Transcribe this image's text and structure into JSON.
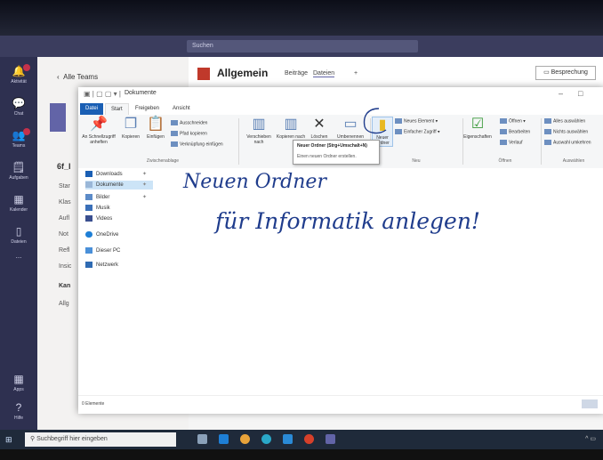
{
  "teams": {
    "search_placeholder": "Suchen",
    "rail": [
      {
        "label": "Aktivität",
        "icon": "bell-icon"
      },
      {
        "label": "Chat",
        "icon": "chat-icon"
      },
      {
        "label": "Teams",
        "icon": "teams-icon"
      },
      {
        "label": "Aufgaben",
        "icon": "tasks-icon"
      },
      {
        "label": "Kalender",
        "icon": "calendar-icon"
      },
      {
        "label": "Dateien",
        "icon": "files-icon"
      },
      {
        "label": "...",
        "icon": "more-icon"
      },
      {
        "label": "Apps",
        "icon": "apps-icon"
      },
      {
        "label": "Hilfe",
        "icon": "help-icon"
      }
    ],
    "all_teams": "Alle Teams",
    "team_name": "6f_I",
    "channels": [
      "Star",
      "Klas",
      "Aufl",
      "Not",
      "Refl",
      "Insic"
    ],
    "section": "Kan",
    "channel_general": "Allg",
    "channel_title": "Allgemein",
    "tabs": [
      "Beiträge",
      "Dateien",
      "+"
    ],
    "meet_button": "Besprechung"
  },
  "explorer": {
    "title": "Dokumente",
    "ribbon_tabs": [
      "Datei",
      "Start",
      "Freigeben",
      "Ansicht"
    ],
    "ribbon": {
      "pin": "An Schnellzugriff anheften",
      "copy": "Kopieren",
      "paste": "Einfügen",
      "cut": "Ausschneiden",
      "copy_path": "Pfad kopieren",
      "paste_shortcut": "Verknüpfung einfügen",
      "group_clipboard": "Zwischenablage",
      "move_to": "Verschieben nach",
      "copy_to": "Kopieren nach",
      "delete": "Löschen",
      "rename": "Umbenennen",
      "group_organize": "Organisieren",
      "new_folder": "Neuer Ordner",
      "new_item": "Neues Element",
      "easy_access": "Einfacher Zugriff",
      "group_new": "Neu",
      "properties": "Eigenschaften",
      "open": "Öffnen",
      "edit": "Bearbeiten",
      "history": "Verlauf",
      "group_open": "Öffnen",
      "select_all": "Alles auswählen",
      "select_none": "Nichts auswählen",
      "invert_selection": "Auswahl umkehren",
      "group_select": "Auswählen"
    },
    "tooltip": {
      "title": "Neuer Ordner (Strg+Umschalt+N)",
      "text": "Einen neuen Ordner erstellen."
    },
    "nav": [
      {
        "label": "Downloads",
        "pinned": true
      },
      {
        "label": "Dokumente",
        "pinned": true,
        "selected": true
      },
      {
        "label": "Bilder",
        "pinned": true
      },
      {
        "label": "Musik",
        "pinned": false
      },
      {
        "label": "Videos",
        "pinned": false
      },
      {
        "label": "OneDrive",
        "pinned": false
      },
      {
        "label": "Dieser PC",
        "pinned": false
      },
      {
        "label": "Netzwerk",
        "pinned": false
      }
    ],
    "status": "0 Elemente"
  },
  "handwriting": {
    "line1": "Neuen Ordner",
    "line2": "für Informatik anlegen!"
  },
  "taskbar": {
    "search_placeholder": "Suchbegriff hier eingeben"
  },
  "colors": {
    "accent": "#1a5fb4",
    "teams": "#3b3d5e",
    "ink": "#1f3c8c"
  }
}
